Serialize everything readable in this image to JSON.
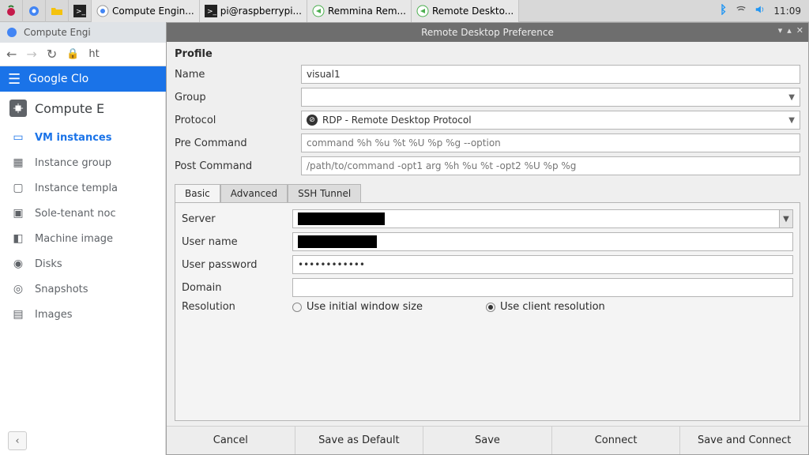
{
  "taskbar": {
    "apps": [
      {
        "name": "raspberry-menu"
      },
      {
        "name": "chromium"
      },
      {
        "name": "file-manager"
      },
      {
        "name": "terminal"
      }
    ],
    "windows": [
      {
        "label": "Compute Engin..."
      },
      {
        "label": "pi@raspberrypi..."
      },
      {
        "label": "Remmina Rem..."
      },
      {
        "label": "Remote Deskto..."
      }
    ],
    "clock": "11:09"
  },
  "browser": {
    "tab_title": "Compute Engi",
    "url_fragment": "ht"
  },
  "gcloud": {
    "bar_label": "Google Clo",
    "section": "Compute E",
    "nav": [
      {
        "label": "VM instances",
        "active": true
      },
      {
        "label": "Instance group"
      },
      {
        "label": "Instance templa"
      },
      {
        "label": "Sole-tenant noc"
      },
      {
        "label": "Machine image"
      },
      {
        "label": "Disks"
      },
      {
        "label": "Snapshots"
      },
      {
        "label": "Images"
      }
    ]
  },
  "dialog": {
    "title": "Remote Desktop Preference",
    "heading": "Profile",
    "labels": {
      "name": "Name",
      "group": "Group",
      "protocol": "Protocol",
      "pre": "Pre Command",
      "post": "Post Command",
      "server": "Server",
      "username": "User name",
      "password": "User password",
      "domain": "Domain",
      "resolution": "Resolution"
    },
    "values": {
      "name": "visual1",
      "group": "",
      "protocol": "RDP - Remote Desktop Protocol",
      "password_mask": "••••••••••••",
      "domain": ""
    },
    "placeholders": {
      "pre": "command %h %u %t %U %p %g --option",
      "post": "/path/to/command -opt1 arg %h %u %t -opt2 %U %p %g"
    },
    "tabs": [
      "Basic",
      "Advanced",
      "SSH Tunnel"
    ],
    "active_tab": "Basic",
    "resolution_options": {
      "initial": "Use initial window size",
      "client": "Use client resolution"
    },
    "resolution_selected": "client",
    "buttons": {
      "cancel": "Cancel",
      "save_default": "Save as Default",
      "save": "Save",
      "connect": "Connect",
      "save_connect": "Save and Connect"
    }
  }
}
